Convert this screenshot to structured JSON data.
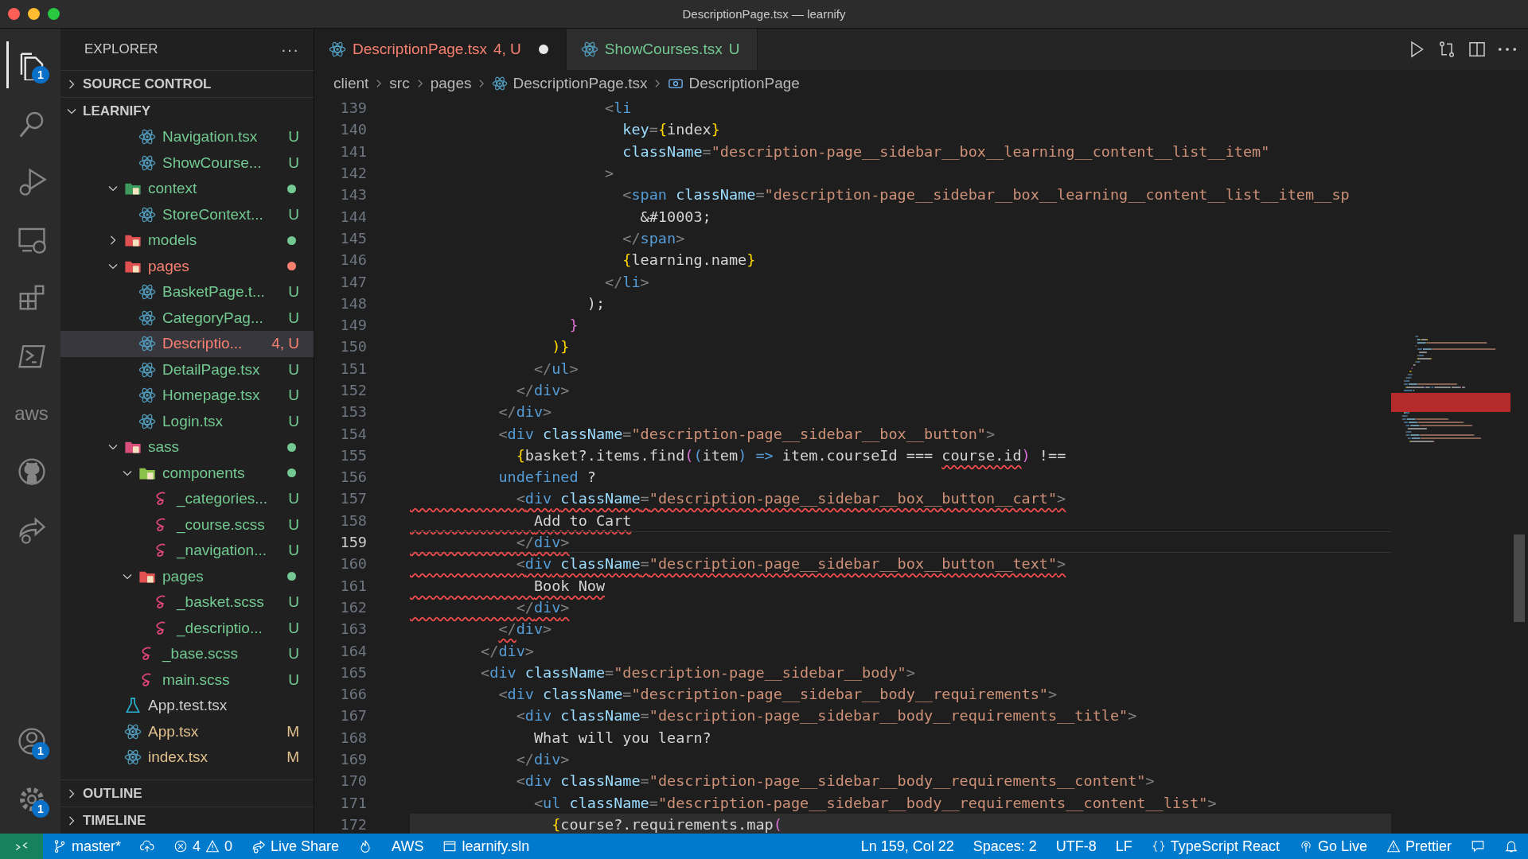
{
  "window": {
    "title": "DescriptionPage.tsx — learnify"
  },
  "activity_bar": [
    {
      "kind": "files",
      "badge": "1",
      "selected": true
    },
    {
      "kind": "search",
      "selected": false
    },
    {
      "kind": "run-debug",
      "selected": false
    },
    {
      "kind": "remote",
      "selected": false
    },
    {
      "kind": "extensions",
      "selected": false
    },
    {
      "kind": "terminal",
      "selected": false
    },
    {
      "kind": "aws",
      "text": "aws",
      "selected": false
    },
    {
      "kind": "github",
      "selected": false
    },
    {
      "kind": "live-share",
      "selected": false
    }
  ],
  "activity_bar_bottom": [
    {
      "kind": "account",
      "badge": "1",
      "selected": false
    },
    {
      "kind": "settings",
      "badge": "1",
      "selected": false
    }
  ],
  "explorer": {
    "title": "EXPLORER",
    "more": "···",
    "sections": [
      {
        "label": "SOURCE CONTROL",
        "expanded": false
      },
      {
        "label": "LEARNIFY",
        "expanded": true
      }
    ],
    "tree": [
      {
        "children": [
          {
            "label": "Navigation.tsx",
            "kind": "react",
            "color": "#73c991",
            "badge": "U",
            "selected": false
          },
          {
            "label": "ShowCourse...",
            "kind": "react",
            "color": "#73c991",
            "badge": "U",
            "selected": false
          }
        ]
      },
      {
        "label": "context",
        "kind": "folder-green",
        "color": "#73c991",
        "expanded": true,
        "selected": false,
        "children": [
          {
            "label": "StoreContext...",
            "kind": "react",
            "color": "#73c991",
            "badge": "U",
            "selected": false
          }
        ]
      },
      {
        "label": "models",
        "kind": "folder-red",
        "color": "#73c991",
        "expanded": false,
        "selected": false
      },
      {
        "label": "pages",
        "kind": "folder-red",
        "color": "#f88070",
        "expanded": true,
        "selected": false,
        "children": [
          {
            "label": "BasketPage.t...",
            "kind": "react",
            "color": "#73c991",
            "badge": "U",
            "selected": false
          },
          {
            "label": "CategoryPag...",
            "kind": "react",
            "color": "#73c991",
            "badge": "U",
            "selected": false
          },
          {
            "label": "Descriptio...",
            "kind": "react",
            "color": "#f88070",
            "badge": "4, U",
            "selected": true
          },
          {
            "label": "DetailPage.tsx",
            "kind": "react",
            "color": "#73c991",
            "badge": "U",
            "selected": false
          },
          {
            "label": "Homepage.tsx",
            "kind": "react",
            "color": "#73c991",
            "badge": "U",
            "selected": false
          },
          {
            "label": "Login.tsx",
            "kind": "react",
            "color": "#73c991",
            "badge": "U",
            "selected": false
          }
        ]
      },
      {
        "label": "sass",
        "kind": "folder-pink",
        "color": "#73c991",
        "expanded": true,
        "selected": false,
        "children": [
          {
            "label": "components",
            "kind": "folder-lime",
            "color": "#73c991",
            "expanded": true,
            "selected": false,
            "children": [
              {
                "label": "_categories...",
                "kind": "sass",
                "color": "#73c991",
                "badge": "U",
                "selected": false
              },
              {
                "label": "_course.scss",
                "kind": "sass",
                "color": "#73c991",
                "badge": "U",
                "selected": false
              },
              {
                "label": "_navigation...",
                "kind": "sass",
                "color": "#73c991",
                "badge": "U",
                "selected": false
              }
            ]
          },
          {
            "label": "pages",
            "kind": "folder-red",
            "color": "#73c991",
            "expanded": true,
            "selected": false,
            "children": [
              {
                "label": "_basket.scss",
                "kind": "sass",
                "color": "#73c991",
                "badge": "U",
                "selected": false
              },
              {
                "label": "_descriptio...",
                "kind": "sass",
                "color": "#73c991",
                "badge": "U",
                "selected": false
              }
            ]
          },
          {
            "label": "_base.scss",
            "kind": "sass",
            "color": "#73c991",
            "badge": "U",
            "selected": false
          },
          {
            "label": "main.scss",
            "kind": "sass",
            "color": "#73c991",
            "badge": "U",
            "selected": false
          }
        ]
      },
      {
        "label": "App.test.tsx",
        "kind": "test",
        "color": "#cccccc",
        "selected": false
      },
      {
        "label": "App.tsx",
        "kind": "react",
        "color": "#e2c08d",
        "badge": "M",
        "selected": false
      },
      {
        "label": "index.tsx",
        "kind": "react",
        "color": "#e2c08d",
        "badge": "M",
        "selected": false
      }
    ],
    "bottom_sections": [
      {
        "label": "OUTLINE",
        "expanded": false
      },
      {
        "label": "TIMELINE",
        "expanded": false
      }
    ]
  },
  "tabs": [
    {
      "label": "DescriptionPage.tsx",
      "badge": "4, U",
      "color": "#f88070",
      "dirty": true,
      "selected": true
    },
    {
      "label": "ShowCourses.tsx",
      "badge": "U",
      "color": "#73c991",
      "dirty": false,
      "selected": false
    }
  ],
  "tab_actions": [
    {
      "kind": "run"
    },
    {
      "kind": "compare"
    },
    {
      "kind": "split"
    },
    {
      "kind": "more"
    }
  ],
  "breadcrumb": [
    {
      "text": "client"
    },
    {
      "text": "src"
    },
    {
      "text": "pages"
    },
    {
      "text": "DescriptionPage.tsx",
      "kind": "react"
    },
    {
      "text": "DescriptionPage",
      "kind": "symbol"
    }
  ],
  "code": {
    "lines": [
      {
        "number": "139",
        "error": false,
        "current": false,
        "highlighted": false,
        "tokens": [
          {
            "kind": "punct",
            "text": "                      <"
          },
          {
            "kind": "tag",
            "text": "li"
          }
        ]
      },
      {
        "number": "140",
        "error": false,
        "current": false,
        "highlighted": false,
        "tokens": [
          {
            "kind": "attr",
            "text": "                        key"
          },
          {
            "kind": "punct",
            "text": "="
          },
          {
            "kind": "brace",
            "text": "{"
          },
          {
            "kind": "plain",
            "text": "index"
          },
          {
            "kind": "brace",
            "text": "}"
          }
        ]
      },
      {
        "number": "141",
        "error": false,
        "current": false,
        "highlighted": false,
        "tokens": [
          {
            "kind": "attr",
            "text": "                        className"
          },
          {
            "kind": "punct",
            "text": "="
          },
          {
            "kind": "string",
            "text": "\"description-page__sidebar__box__learning__content__list__item\""
          }
        ]
      },
      {
        "number": "142",
        "error": false,
        "current": false,
        "highlighted": false,
        "tokens": [
          {
            "kind": "punct",
            "text": "                      >"
          }
        ]
      },
      {
        "number": "143",
        "error": false,
        "current": false,
        "highlighted": false,
        "tokens": [
          {
            "kind": "punct",
            "text": "                        <"
          },
          {
            "kind": "tag",
            "text": "span"
          },
          {
            "kind": "attr",
            "text": " className"
          },
          {
            "kind": "punct",
            "text": "="
          },
          {
            "kind": "string",
            "text": "\"description-page__sidebar__box__learning__content__list__item__sp"
          }
        ]
      },
      {
        "number": "144",
        "error": false,
        "current": false,
        "highlighted": false,
        "tokens": [
          {
            "kind": "plain",
            "text": "                          &#10003;"
          }
        ]
      },
      {
        "number": "145",
        "error": false,
        "current": false,
        "highlighted": false,
        "tokens": [
          {
            "kind": "punct",
            "text": "                        </"
          },
          {
            "kind": "tag",
            "text": "span"
          },
          {
            "kind": "punct",
            "text": ">"
          }
        ]
      },
      {
        "number": "146",
        "error": false,
        "current": false,
        "highlighted": false,
        "tokens": [
          {
            "kind": "brace",
            "text": "                        {"
          },
          {
            "kind": "plain",
            "text": "learning.name"
          },
          {
            "kind": "brace",
            "text": "}"
          }
        ]
      },
      {
        "number": "147",
        "error": false,
        "current": false,
        "highlighted": false,
        "tokens": [
          {
            "kind": "punct",
            "text": "                      </"
          },
          {
            "kind": "tag",
            "text": "li"
          },
          {
            "kind": "punct",
            "text": ">"
          }
        ]
      },
      {
        "number": "148",
        "error": false,
        "current": false,
        "highlighted": false,
        "tokens": [
          {
            "kind": "plain",
            "text": "                    );"
          }
        ]
      },
      {
        "number": "149",
        "error": false,
        "current": false,
        "highlighted": false,
        "tokens": [
          {
            "kind": "bracket",
            "text": "                  }"
          }
        ]
      },
      {
        "number": "150",
        "error": false,
        "current": false,
        "highlighted": false,
        "tokens": [
          {
            "kind": "brace",
            "text": "                )}"
          }
        ]
      },
      {
        "number": "151",
        "error": false,
        "current": false,
        "highlighted": false,
        "tokens": [
          {
            "kind": "punct",
            "text": "              </"
          },
          {
            "kind": "tag",
            "text": "ul"
          },
          {
            "kind": "punct",
            "text": ">"
          }
        ]
      },
      {
        "number": "152",
        "error": false,
        "current": false,
        "highlighted": false,
        "tokens": [
          {
            "kind": "punct",
            "text": "            </"
          },
          {
            "kind": "tag",
            "text": "div"
          },
          {
            "kind": "punct",
            "text": ">"
          }
        ]
      },
      {
        "number": "153",
        "error": false,
        "current": false,
        "highlighted": false,
        "tokens": [
          {
            "kind": "punct",
            "text": "          </"
          },
          {
            "kind": "tag",
            "text": "div"
          },
          {
            "kind": "punct",
            "text": ">"
          }
        ]
      },
      {
        "number": "154",
        "error": false,
        "current": false,
        "highlighted": false,
        "tokens": [
          {
            "kind": "punct",
            "text": "          <"
          },
          {
            "kind": "tag",
            "text": "div"
          },
          {
            "kind": "attr",
            "text": " className"
          },
          {
            "kind": "punct",
            "text": "="
          },
          {
            "kind": "string",
            "text": "\"description-page__sidebar__box__button\""
          },
          {
            "kind": "punct",
            "text": ">"
          }
        ]
      },
      {
        "number": "155",
        "error": false,
        "current": false,
        "highlighted": false,
        "tokens": [
          {
            "kind": "brace",
            "text": "            {"
          },
          {
            "kind": "plain",
            "text": "basket?.items.find"
          },
          {
            "kind": "bracket",
            "text": "("
          },
          {
            "kind": "keyword",
            "text": "("
          },
          {
            "kind": "plain",
            "text": "item"
          },
          {
            "kind": "keyword",
            "text": ")"
          },
          {
            "kind": "keyword",
            "text": " =>"
          },
          {
            "kind": "plain",
            "text": " item.courseId ==="
          },
          {
            "kind": "plain-error",
            "text": " course.id"
          },
          {
            "kind": "bracket",
            "text": ")"
          },
          {
            "kind": "plain",
            "text": " !=="
          }
        ]
      },
      {
        "number": "156",
        "error": false,
        "current": false,
        "highlighted": false,
        "tokens": [
          {
            "kind": "keyword",
            "text": "          undefined"
          },
          {
            "kind": "plain",
            "text": " ?"
          }
        ]
      },
      {
        "number": "157",
        "error": true,
        "current": false,
        "highlighted": false,
        "tokens": [
          {
            "kind": "punct",
            "text": "            <"
          },
          {
            "kind": "tag",
            "text": "div"
          },
          {
            "kind": "attr",
            "text": " className"
          },
          {
            "kind": "punct",
            "text": "="
          },
          {
            "kind": "string",
            "text": "\"description-page__sidebar__box__button__cart\""
          },
          {
            "kind": "punct",
            "text": ">"
          }
        ]
      },
      {
        "number": "158",
        "error": true,
        "current": false,
        "highlighted": false,
        "tokens": [
          {
            "kind": "plain",
            "text": "              Add to Cart"
          }
        ]
      },
      {
        "number": "159",
        "error": true,
        "current": true,
        "highlighted": false,
        "tokens": [
          {
            "kind": "punct",
            "text": "            </"
          },
          {
            "kind": "tag",
            "text": "div"
          },
          {
            "kind": "punct",
            "text": ">"
          }
        ]
      },
      {
        "number": "160",
        "error": true,
        "current": false,
        "highlighted": false,
        "tokens": [
          {
            "kind": "punct",
            "text": "            <"
          },
          {
            "kind": "tag",
            "text": "div"
          },
          {
            "kind": "attr",
            "text": " className"
          },
          {
            "kind": "punct",
            "text": "="
          },
          {
            "kind": "string",
            "text": "\"description-page__sidebar__box__button__text\""
          },
          {
            "kind": "punct",
            "text": ">"
          }
        ]
      },
      {
        "number": "161",
        "error": true,
        "current": false,
        "highlighted": false,
        "tokens": [
          {
            "kind": "plain",
            "text": "              Book Now"
          }
        ]
      },
      {
        "number": "162",
        "error": true,
        "current": false,
        "highlighted": false,
        "tokens": [
          {
            "kind": "punct",
            "text": "            </"
          },
          {
            "kind": "tag",
            "text": "div"
          },
          {
            "kind": "punct",
            "text": ">"
          }
        ]
      },
      {
        "number": "163",
        "error": false,
        "current": false,
        "highlighted": false,
        "tokens": [
          {
            "kind": "punct-error",
            "text": "          </"
          },
          {
            "kind": "tag",
            "text": "div"
          },
          {
            "kind": "punct",
            "text": ">"
          }
        ]
      },
      {
        "number": "164",
        "error": false,
        "current": false,
        "highlighted": false,
        "tokens": [
          {
            "kind": "punct",
            "text": "        </"
          },
          {
            "kind": "tag",
            "text": "div"
          },
          {
            "kind": "punct",
            "text": ">"
          }
        ]
      },
      {
        "number": "165",
        "error": false,
        "current": false,
        "highlighted": false,
        "tokens": [
          {
            "kind": "punct",
            "text": "        <"
          },
          {
            "kind": "tag",
            "text": "div"
          },
          {
            "kind": "attr",
            "text": " className"
          },
          {
            "kind": "punct",
            "text": "="
          },
          {
            "kind": "string",
            "text": "\"description-page__sidebar__body\""
          },
          {
            "kind": "punct",
            "text": ">"
          }
        ]
      },
      {
        "number": "166",
        "error": false,
        "current": false,
        "highlighted": false,
        "tokens": [
          {
            "kind": "punct",
            "text": "          <"
          },
          {
            "kind": "tag",
            "text": "div"
          },
          {
            "kind": "attr",
            "text": " className"
          },
          {
            "kind": "punct",
            "text": "="
          },
          {
            "kind": "string",
            "text": "\"description-page__sidebar__body__requirements\""
          },
          {
            "kind": "punct",
            "text": ">"
          }
        ]
      },
      {
        "number": "167",
        "error": false,
        "current": false,
        "highlighted": false,
        "tokens": [
          {
            "kind": "punct",
            "text": "            <"
          },
          {
            "kind": "tag",
            "text": "div"
          },
          {
            "kind": "attr",
            "text": " className"
          },
          {
            "kind": "punct",
            "text": "="
          },
          {
            "kind": "string",
            "text": "\"description-page__sidebar__body__requirements__title\""
          },
          {
            "kind": "punct",
            "text": ">"
          }
        ]
      },
      {
        "number": "168",
        "error": false,
        "current": false,
        "highlighted": false,
        "tokens": [
          {
            "kind": "plain",
            "text": "              What will you learn?"
          }
        ]
      },
      {
        "number": "169",
        "error": false,
        "current": false,
        "highlighted": false,
        "tokens": [
          {
            "kind": "punct",
            "text": "            </"
          },
          {
            "kind": "tag",
            "text": "div"
          },
          {
            "kind": "punct",
            "text": ">"
          }
        ]
      },
      {
        "number": "170",
        "error": false,
        "current": false,
        "highlighted": false,
        "tokens": [
          {
            "kind": "punct",
            "text": "            <"
          },
          {
            "kind": "tag",
            "text": "div"
          },
          {
            "kind": "attr",
            "text": " className"
          },
          {
            "kind": "punct",
            "text": "="
          },
          {
            "kind": "string",
            "text": "\"description-page__sidebar__body__requirements__content\""
          },
          {
            "kind": "punct",
            "text": ">"
          }
        ]
      },
      {
        "number": "171",
        "error": false,
        "current": false,
        "highlighted": false,
        "tokens": [
          {
            "kind": "punct",
            "text": "              <"
          },
          {
            "kind": "tag",
            "text": "ul"
          },
          {
            "kind": "attr",
            "text": " className"
          },
          {
            "kind": "punct",
            "text": "="
          },
          {
            "kind": "string",
            "text": "\"description-page__sidebar__body__requirements__content__list\""
          },
          {
            "kind": "punct",
            "text": ">"
          }
        ]
      },
      {
        "number": "172",
        "error": false,
        "current": false,
        "highlighted": true,
        "tokens": [
          {
            "kind": "brace",
            "text": "                {"
          },
          {
            "kind": "plain",
            "text": "course?.requirements.map"
          },
          {
            "kind": "bracket",
            "text": "("
          }
        ]
      }
    ]
  },
  "status_bar": {
    "left": [
      {
        "kind": "remote"
      },
      {
        "kind": "branch",
        "text": "master*"
      },
      {
        "kind": "cloud-upload"
      },
      {
        "kind": "problems",
        "errors": "4",
        "warnings": "0"
      },
      {
        "kind": "live-share",
        "text": "Live Share"
      },
      {
        "kind": "flame"
      },
      {
        "kind": "text",
        "text": "AWS"
      },
      {
        "kind": "window",
        "text": "learnify.sln"
      }
    ],
    "right": [
      {
        "kind": "text",
        "text": "Ln 159, Col 22"
      },
      {
        "kind": "text",
        "text": "Spaces: 2"
      },
      {
        "kind": "text",
        "text": "UTF-8"
      },
      {
        "kind": "text",
        "text": "LF"
      },
      {
        "kind": "braces",
        "text": "TypeScript React"
      },
      {
        "kind": "broadcast",
        "text": "Go Live"
      },
      {
        "kind": "warning",
        "text": "Prettier"
      },
      {
        "kind": "feedback"
      },
      {
        "kind": "bell"
      }
    ]
  }
}
